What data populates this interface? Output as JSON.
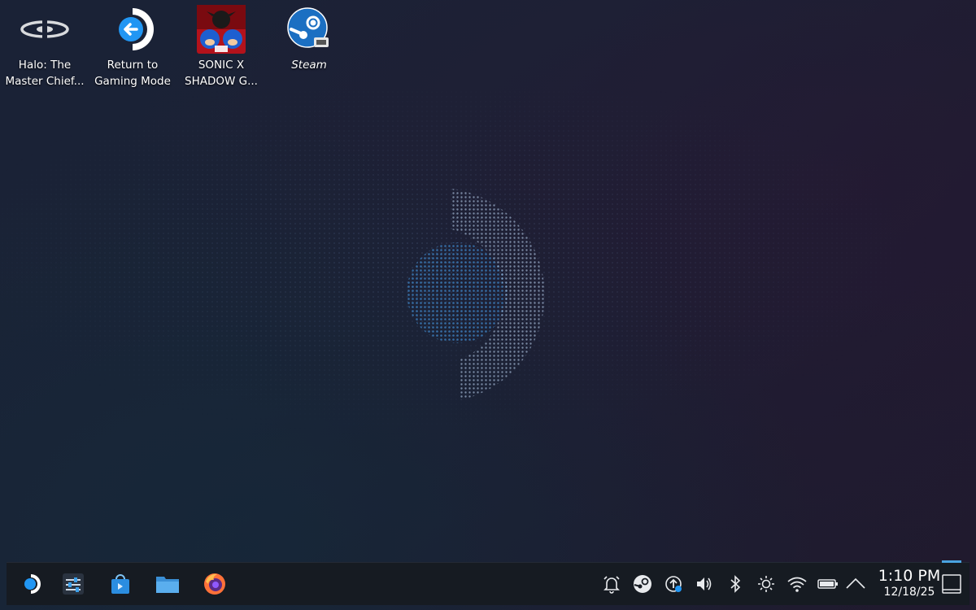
{
  "desktop": {
    "icons": [
      {
        "label": "Halo: The\nMaster Chief...",
        "icon": "halo-icon"
      },
      {
        "label": "Return to\nGaming Mode",
        "icon": "return-arrow-icon"
      },
      {
        "label": "SONIC X\nSHADOW G...",
        "icon": "sonic-game-icon"
      },
      {
        "label": "Steam",
        "icon": "steam-icon"
      }
    ]
  },
  "taskbar": {
    "launchers": [
      {
        "icon": "steamos-launcher-icon"
      },
      {
        "icon": "system-settings-icon"
      },
      {
        "icon": "discover-store-icon"
      },
      {
        "icon": "file-manager-icon"
      },
      {
        "icon": "firefox-icon"
      }
    ],
    "tray": [
      {
        "icon": "notifications-bell-icon"
      },
      {
        "icon": "steam-tray-icon"
      },
      {
        "icon": "updates-icon"
      },
      {
        "icon": "volume-icon"
      },
      {
        "icon": "bluetooth-icon"
      },
      {
        "icon": "brightness-icon"
      },
      {
        "icon": "wifi-icon"
      },
      {
        "icon": "battery-icon"
      },
      {
        "icon": "chevron-up-icon"
      }
    ],
    "clock": {
      "time": "1:10 PM",
      "date": "12/18/25"
    }
  },
  "colors": {
    "accent": "#2196f3",
    "taskbar": "#161b22"
  }
}
